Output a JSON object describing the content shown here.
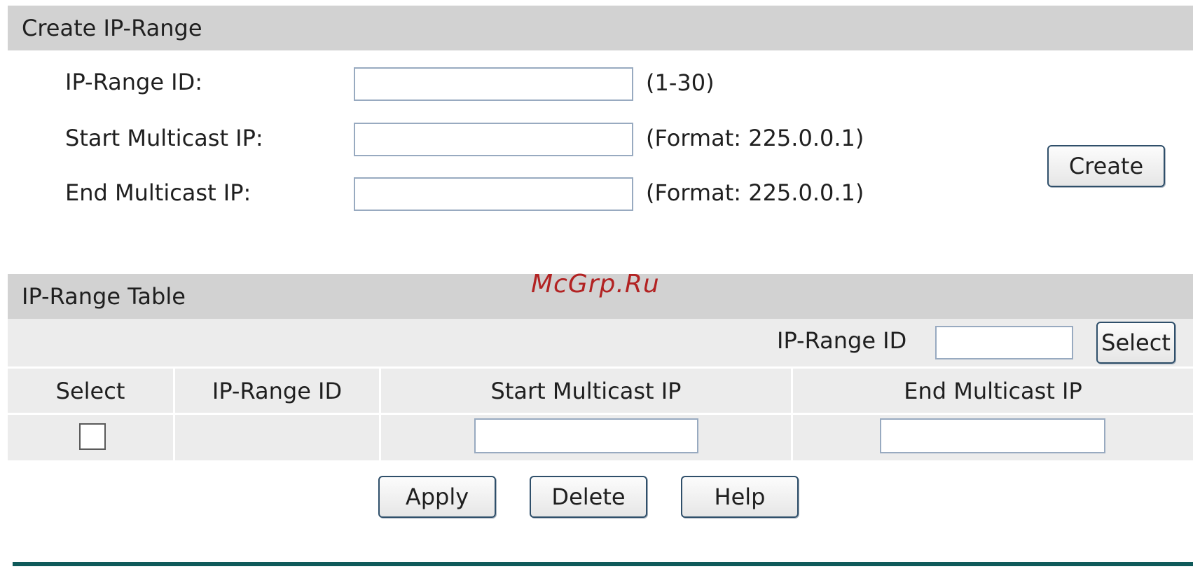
{
  "create_section": {
    "title": "Create IP-Range",
    "fields": {
      "range_id": {
        "label": "IP-Range ID:",
        "value": "",
        "hint": "(1-30)"
      },
      "start_ip": {
        "label": "Start Multicast IP:",
        "value": "",
        "hint": "(Format: 225.0.0.1)"
      },
      "end_ip": {
        "label": "End Multicast IP:",
        "value": "",
        "hint": "(Format: 225.0.0.1)"
      }
    },
    "create_label": "Create"
  },
  "watermark": "McGrp.Ru",
  "table_section": {
    "title": "IP-Range Table",
    "search": {
      "label": "IP-Range ID",
      "value": "",
      "select_label": "Select"
    },
    "columns": [
      "Select",
      "IP-Range ID",
      "Start Multicast IP",
      "End Multicast IP"
    ],
    "row": {
      "checked": false,
      "range_id": "",
      "start_ip": "",
      "end_ip": ""
    },
    "buttons": {
      "apply": "Apply",
      "delete": "Delete",
      "help": "Help"
    }
  },
  "colors": {
    "header_bg": "#d2d2d2",
    "table_bg": "#ececec",
    "input_border": "#98aac0",
    "button_border": "#2f4f6a",
    "footer_line": "#0f5a5a",
    "watermark": "#b22222"
  }
}
